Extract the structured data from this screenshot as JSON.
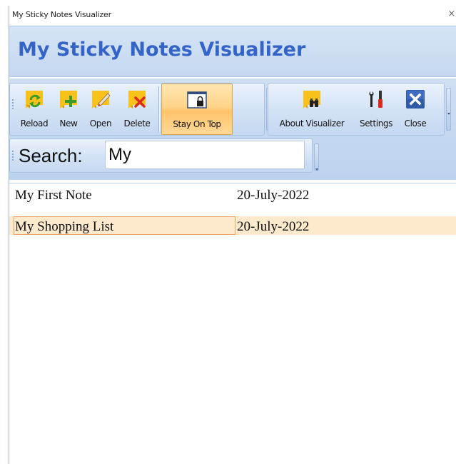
{
  "window": {
    "title": "My Sticky Notes Visualizer",
    "close_glyph": "×"
  },
  "header": {
    "app_title": "My Sticky Notes Visualizer"
  },
  "toolbar1": {
    "buttons": [
      {
        "label": "Reload",
        "icon": "reload-note-icon"
      },
      {
        "label": "New",
        "icon": "new-note-icon"
      },
      {
        "label": "Open",
        "icon": "edit-note-icon"
      },
      {
        "label": "Delete",
        "icon": "delete-note-icon"
      }
    ],
    "toggle": {
      "label": "Stay On Top",
      "icon": "lock-window-icon",
      "active": true
    }
  },
  "toolbar2": {
    "buttons": [
      {
        "label": "About Visualizer",
        "icon": "binoculars-note-icon"
      },
      {
        "label": "Settings",
        "icon": "tools-icon"
      },
      {
        "label": "Close",
        "icon": "close-icon"
      }
    ]
  },
  "search": {
    "label": "Search:",
    "value": "My"
  },
  "notes": [
    {
      "name": "My First Note",
      "date": "20-July-2022",
      "selected": false
    },
    {
      "name": "My Shopping List",
      "date": "20-July-2022",
      "selected": true
    }
  ],
  "colors": {
    "title_blue": "#3564c9",
    "note_yellow": "#f9c21a",
    "active_orange": "#ffc46b",
    "selected_row": "#fde9cc"
  }
}
